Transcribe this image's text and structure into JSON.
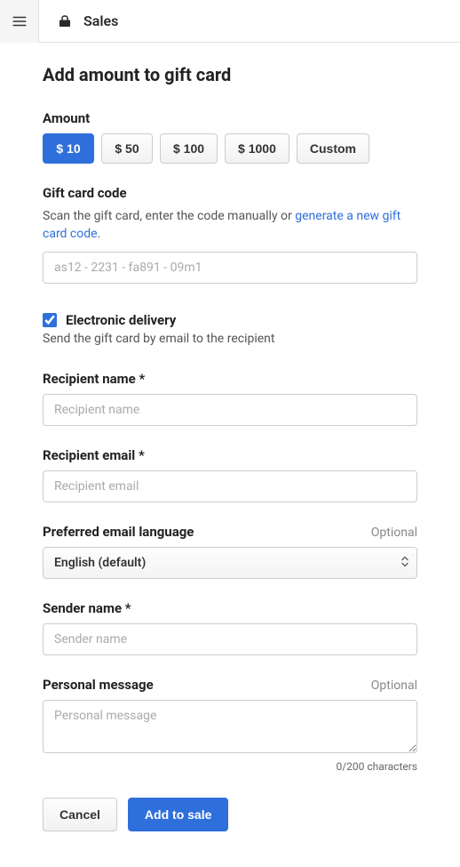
{
  "header": {
    "title": "Sales"
  },
  "page": {
    "title": "Add amount to gift card"
  },
  "amount": {
    "label": "Amount",
    "options": [
      "$ 10",
      "$ 50",
      "$ 100",
      "$ 1000",
      "Custom"
    ],
    "selected_index": 0
  },
  "gift_card_code": {
    "label": "Gift card code",
    "helper_before_link": "Scan the gift card, enter the code manually or ",
    "link_text": "generate a new gift card code",
    "helper_after_link": ".",
    "placeholder": "as12 - 2231 - fa891 - 09m1",
    "value": ""
  },
  "electronic": {
    "checked": true,
    "label": "Electronic delivery",
    "helper": "Send the gift card by email to the recipient"
  },
  "recipient_name": {
    "label": "Recipient name",
    "required_mark": "*",
    "placeholder": "Recipient name",
    "value": ""
  },
  "recipient_email": {
    "label": "Recipient email",
    "required_mark": "*",
    "placeholder": "Recipient email",
    "value": ""
  },
  "email_language": {
    "label": "Preferred email language",
    "optional": "Optional",
    "selected": "English (default)"
  },
  "sender_name": {
    "label": "Sender name",
    "required_mark": "*",
    "placeholder": "Sender name",
    "value": ""
  },
  "personal_message": {
    "label": "Personal message",
    "optional": "Optional",
    "placeholder": "Personal message",
    "value": "",
    "char_count": "0/200 characters"
  },
  "buttons": {
    "cancel": "Cancel",
    "add_to_sale": "Add to sale"
  }
}
